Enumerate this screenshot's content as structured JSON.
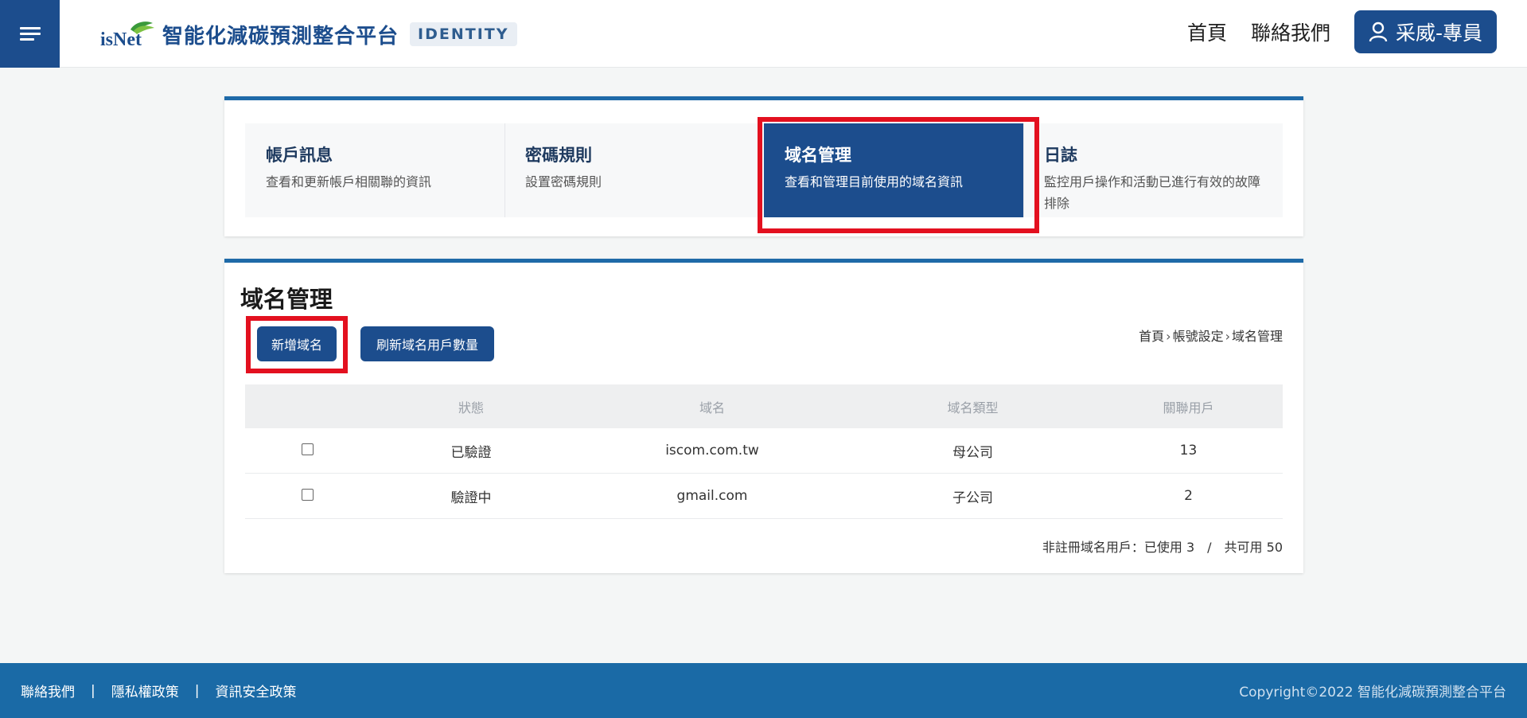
{
  "header": {
    "menu_icon": "hamburger-icon",
    "logo_text": "isNet",
    "title": "智能化減碳預測整合平台",
    "badge": "IDENTITY",
    "nav": [
      {
        "label": "首頁"
      },
      {
        "label": "聯絡我們"
      }
    ],
    "user_label": "采威-專員",
    "user_icon": "user-icon"
  },
  "tabs": [
    {
      "title": "帳戶訊息",
      "desc": "查看和更新帳戶相關聯的資訊"
    },
    {
      "title": "密碼規則",
      "desc": "設置密碼規則"
    },
    {
      "title": "域名管理",
      "desc": "查看和管理目前使用的域名資訊"
    },
    {
      "title": "日誌",
      "desc": "監控用戶操作和活動已進行有效的故障排除"
    }
  ],
  "active_tab_index": 2,
  "main": {
    "title": "域名管理",
    "add_button": "新增域名",
    "refresh_button": "刷新域名用戶數量",
    "breadcrumb": [
      "首頁",
      "帳號設定",
      "域名管理"
    ],
    "breadcrumb_sep": "›",
    "table": {
      "headers": [
        "",
        "狀態",
        "域名",
        "域名類型",
        "關聯用戶"
      ],
      "rows": [
        {
          "status": "已驗證",
          "domain": "iscom.com.tw",
          "type": "母公司",
          "users": "13"
        },
        {
          "status": "驗證中",
          "domain": "gmail.com",
          "type": "子公司",
          "users": "2"
        }
      ]
    },
    "quota_used": "非註冊域名用戶：已使用 3",
    "quota_sep": "/",
    "quota_total": "共可用 50"
  },
  "footer": {
    "links": [
      "聯絡我們",
      "隱私權政策",
      "資訊安全政策"
    ],
    "sep": "|",
    "copyright": "Copyright©2022 智能化減碳預測整合平台"
  },
  "colors": {
    "primary": "#1c4d8d",
    "accent_border": "#1e6aa8",
    "highlight": "#e3101f",
    "footer": "#1a6aa6"
  }
}
